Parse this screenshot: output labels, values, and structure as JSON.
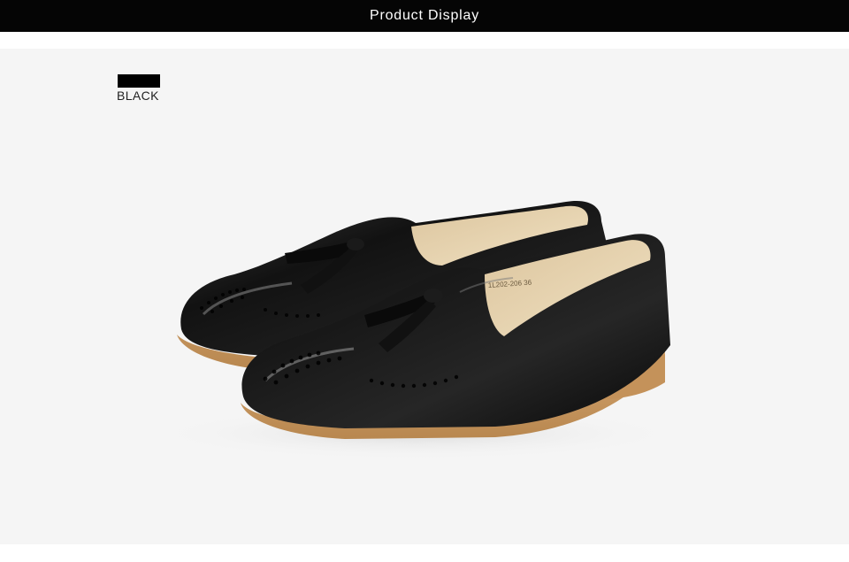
{
  "header": {
    "title": "Product Display",
    "background_color": "#050505",
    "text_color": "#ffffff"
  },
  "product": {
    "color_swatch_hex": "#000000",
    "color_label": "BLACK",
    "image_description_icon": "shoe-image",
    "sole_color": "#c99a66",
    "lining_color": "#e4cfa8",
    "inner_tag": "1L202-206 36"
  },
  "canvas": {
    "photo_background": "#f5f5f5"
  }
}
